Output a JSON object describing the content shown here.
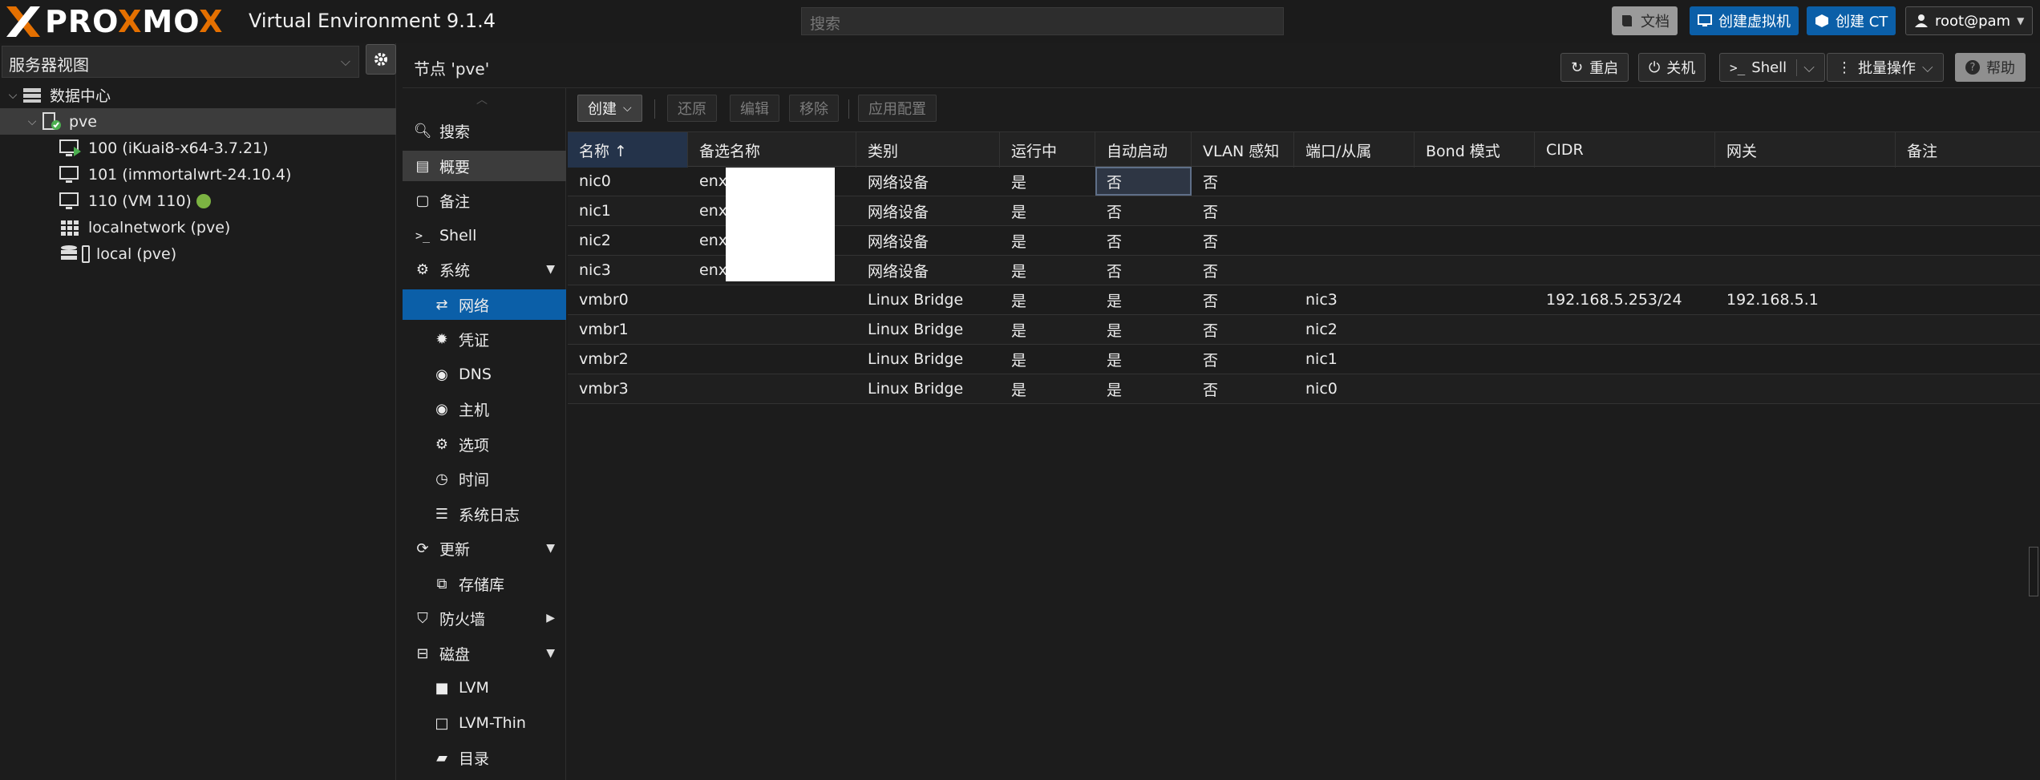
{
  "header": {
    "brand": "PROXMOX",
    "product": "Virtual Environment 9.1.4",
    "search_placeholder": "搜索",
    "buttons": {
      "docs": "文档",
      "create_vm": "创建虚拟机",
      "create_ct": "创建 CT",
      "user": "root@pam"
    }
  },
  "tree": {
    "view": "服务器视图",
    "items": [
      {
        "label": "数据中心"
      },
      {
        "label": "pve"
      },
      {
        "label": "100 (iKuai8-x64-3.7.21)"
      },
      {
        "label": "101 (immortalwrt-24.10.4)"
      },
      {
        "label": "110 (VM 110)"
      },
      {
        "label": "localnetwork (pve)"
      },
      {
        "label": "local (pve)"
      }
    ]
  },
  "node": {
    "title": "节点 'pve'",
    "buttons": {
      "reboot": "重启",
      "shutdown": "关机",
      "shell": "Shell",
      "bulk": "批量操作",
      "help": "帮助"
    }
  },
  "subnav": {
    "items": [
      {
        "label": "搜索"
      },
      {
        "label": "概要"
      },
      {
        "label": "备注"
      },
      {
        "label": "Shell"
      },
      {
        "label": "系统"
      },
      {
        "label": "网络"
      },
      {
        "label": "凭证"
      },
      {
        "label": "DNS"
      },
      {
        "label": "主机"
      },
      {
        "label": "选项"
      },
      {
        "label": "时间"
      },
      {
        "label": "系统日志"
      },
      {
        "label": "更新"
      },
      {
        "label": "存储库"
      },
      {
        "label": "防火墙"
      },
      {
        "label": "磁盘"
      },
      {
        "label": "LVM"
      },
      {
        "label": "LVM-Thin"
      },
      {
        "label": "目录"
      }
    ]
  },
  "toolbar": {
    "create": "创建",
    "revert": "还原",
    "edit": "编辑",
    "remove": "移除",
    "apply": "应用配置"
  },
  "table": {
    "columns": [
      "名称 ↑",
      "备选名称",
      "类别",
      "运行中",
      "自动启动",
      "VLAN 感知",
      "端口/从属",
      "Bond 模式",
      "CIDR",
      "网关",
      "备注"
    ],
    "rows": [
      [
        "nic0",
        "enx",
        "网络设备",
        "是",
        "否",
        "否",
        "",
        "",
        "",
        "",
        ""
      ],
      [
        "nic1",
        "enx",
        "网络设备",
        "是",
        "否",
        "否",
        "",
        "",
        "",
        "",
        ""
      ],
      [
        "nic2",
        "enx",
        "网络设备",
        "是",
        "否",
        "否",
        "",
        "",
        "",
        "",
        ""
      ],
      [
        "nic3",
        "enx",
        "网络设备",
        "是",
        "否",
        "否",
        "",
        "",
        "",
        "",
        ""
      ],
      [
        "vmbr0",
        "",
        "Linux Bridge",
        "是",
        "是",
        "否",
        "nic3",
        "",
        "192.168.5.253/24",
        "192.168.5.1",
        ""
      ],
      [
        "vmbr1",
        "",
        "Linux Bridge",
        "是",
        "是",
        "否",
        "nic2",
        "",
        "",
        "",
        ""
      ],
      [
        "vmbr2",
        "",
        "Linux Bridge",
        "是",
        "是",
        "否",
        "nic1",
        "",
        "",
        "",
        ""
      ],
      [
        "vmbr3",
        "",
        "Linux Bridge",
        "是",
        "是",
        "否",
        "nic0",
        "",
        "",
        "",
        ""
      ]
    ]
  },
  "colors": {
    "accent": "#e57000",
    "selected": "#0b5fa8",
    "running": "#7cb342"
  }
}
